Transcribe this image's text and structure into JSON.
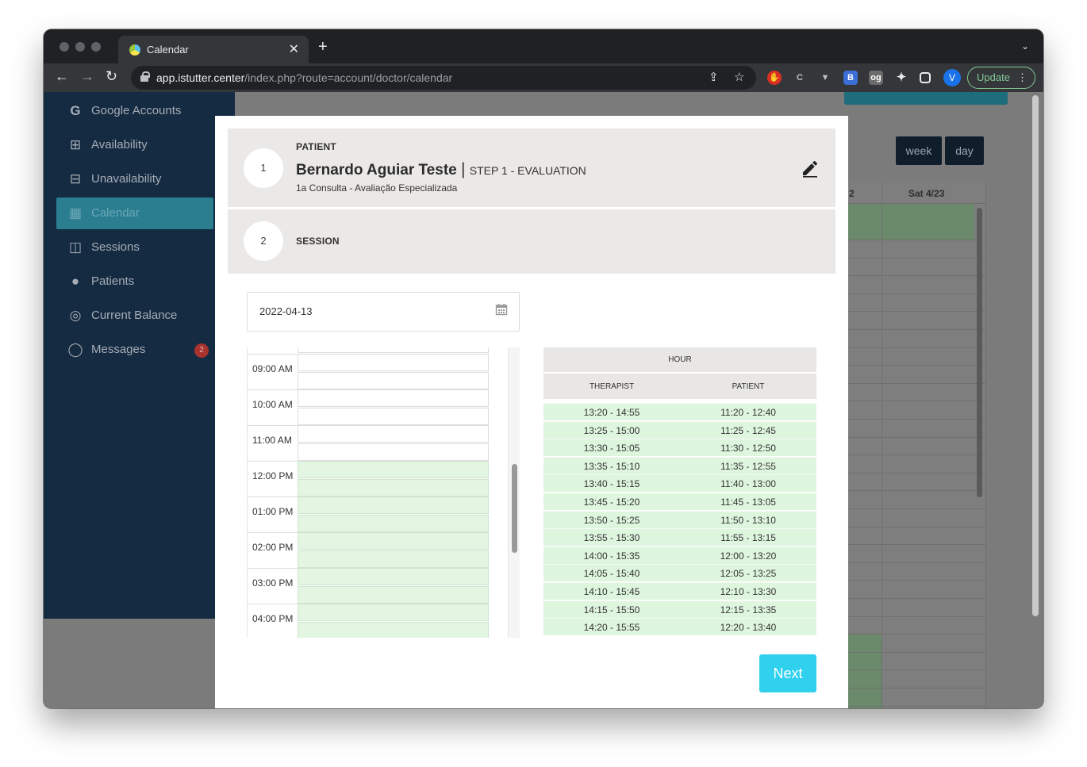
{
  "browser": {
    "tab_title": "Calendar",
    "url_host": "app.istutter.center",
    "url_path": "/index.php?route=account/doctor/calendar",
    "profile_initial": "V",
    "update_label": "Update"
  },
  "sidebar": {
    "items": [
      {
        "label": "Google Accounts",
        "icon": "google-icon"
      },
      {
        "label": "Availability",
        "icon": "calendar-plus-icon"
      },
      {
        "label": "Unavailability",
        "icon": "calendar-minus-icon"
      },
      {
        "label": "Calendar",
        "icon": "calendar-icon",
        "active": true
      },
      {
        "label": "Sessions",
        "icon": "sessions-icon"
      },
      {
        "label": "Patients",
        "icon": "person-icon"
      },
      {
        "label": "Current Balance",
        "icon": "balance-icon"
      },
      {
        "label": "Messages",
        "icon": "chat-icon",
        "badge": "2"
      }
    ]
  },
  "calendar_bg": {
    "view_buttons": [
      "week",
      "day"
    ],
    "column_header": "Sat 4/23",
    "partial_header": "2"
  },
  "modal": {
    "step1": {
      "number": "1",
      "kicker": "PATIENT",
      "patient_name": "Bernardo Aguiar Teste",
      "separator": "|",
      "step_tag": "STEP 1 - EVALUATION",
      "consultation": "1a Consulta - Avaliação Especializada"
    },
    "step2": {
      "number": "2",
      "kicker": "SESSION"
    },
    "date_value": "2022-04-13",
    "day_slots": [
      {
        "time": "09:00 AM",
        "available": false
      },
      {
        "time": "10:00 AM",
        "available": false
      },
      {
        "time": "11:00 AM",
        "available": false
      },
      {
        "time": "12:00 PM",
        "available": true
      },
      {
        "time": "01:00 PM",
        "available": true
      },
      {
        "time": "02:00 PM",
        "available": true
      },
      {
        "time": "03:00 PM",
        "available": true
      },
      {
        "time": "04:00 PM",
        "available": true
      }
    ],
    "hour_table": {
      "header": "HOUR",
      "col_therapist": "THERAPIST",
      "col_patient": "PATIENT",
      "rows": [
        {
          "therapist": "13:20 - 14:55",
          "patient": "11:20 - 12:40"
        },
        {
          "therapist": "13:25 - 15:00",
          "patient": "11:25 - 12:45"
        },
        {
          "therapist": "13:30 - 15:05",
          "patient": "11:30 - 12:50"
        },
        {
          "therapist": "13:35 - 15:10",
          "patient": "11:35 - 12:55"
        },
        {
          "therapist": "13:40 - 15:15",
          "patient": "11:40 - 13:00"
        },
        {
          "therapist": "13:45 - 15:20",
          "patient": "11:45 - 13:05"
        },
        {
          "therapist": "13:50 - 15:25",
          "patient": "11:50 - 13:10"
        },
        {
          "therapist": "13:55 - 15:30",
          "patient": "11:55 - 13:15"
        },
        {
          "therapist": "14:00 - 15:35",
          "patient": "12:00 - 13:20"
        },
        {
          "therapist": "14:05 - 15:40",
          "patient": "12:05 - 13:25"
        },
        {
          "therapist": "14:10 - 15:45",
          "patient": "12:10 - 13:30"
        },
        {
          "therapist": "14:15 - 15:50",
          "patient": "12:15 - 13:35"
        },
        {
          "therapist": "14:20 - 15:55",
          "patient": "12:20 - 13:40"
        }
      ]
    },
    "next_label": "Next"
  },
  "colors": {
    "sidebar_bg": "#152b42",
    "accent_teal": "#2fd1ee",
    "available_green": "#def5de",
    "step_bg": "#ebe9e7"
  }
}
